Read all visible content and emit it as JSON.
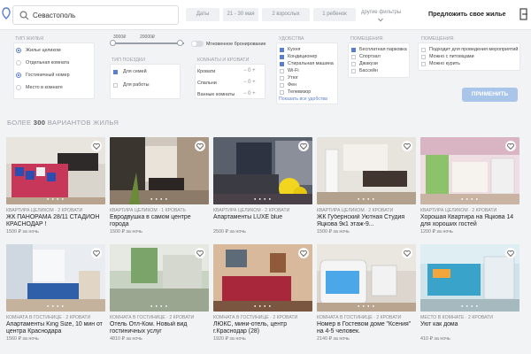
{
  "header": {
    "search_value": "Севастополь",
    "dates": "Даты",
    "date_range": "21 - 30 мая",
    "adults": "2 взрослых",
    "children": "1 ребенок",
    "other_filters": "другие фильтры",
    "offer_link": "Предложить свое жилье",
    "icons": [
      "logo-icon",
      "search-icon",
      "chevron-down-icon",
      "login-icon"
    ]
  },
  "filters": {
    "housing_type": {
      "title": "Тип жилья",
      "options": [
        "Жилье целиком",
        "Отдельная комната",
        "Гостиничный номер",
        "Место в комнате"
      ]
    },
    "price": {
      "min": "3000₽",
      "max": "20000₽"
    },
    "instant_booking": "Мгновенное бронирование",
    "trip_type": {
      "title": "Тип поездки",
      "options": [
        "Для семей",
        "Для работы"
      ]
    },
    "rooms": {
      "title": "Комнаты и кровати",
      "rows": [
        {
          "label": "Кровати",
          "value": "0"
        },
        {
          "label": "Спальни",
          "value": "0"
        },
        {
          "label": "Ванные комнаты",
          "value": "0"
        }
      ]
    },
    "amenities": {
      "title": "Удобства",
      "options": [
        "Кухня",
        "Кондиционер",
        "Стиральная машина",
        "Wi-Fi",
        "Утюг",
        "Фен",
        "Телевизор"
      ],
      "more": "Показать все удобства"
    },
    "facilities": {
      "title": "Помещения",
      "options": [
        "Бесплатная парковка",
        "Спортзал",
        "Джакузи",
        "Бассейн"
      ]
    },
    "rules": {
      "title": "Помещения",
      "options": [
        "Подходит для проведения мероприятий",
        "Можно с питомцами",
        "Можно курить"
      ]
    },
    "apply_label": "Применить"
  },
  "results_count": {
    "prefix": "Более",
    "number": "300",
    "suffix": "вариантов жилья"
  },
  "listings": [
    {
      "type": "Квартира целиком · 2 кровати",
      "title": "ЖК ПАНОРАМА 28/11 СТАДИОН КРАСНОДАР !",
      "price": "1500 ₽ за ночь"
    },
    {
      "type": "Квартира целиком · 1 кровать",
      "title": "Евродвушка в самом центре города",
      "price": "1500 ₽ за ночь"
    },
    {
      "type": "Квартира целиком · 2 кровати",
      "title": "Апартаменты LUXE blue",
      "price": "2500 ₽ за ночь"
    },
    {
      "type": "Квартира целиком · 2 кровати",
      "title": "ЖК Губернский Уютная Студия Яцкова 9к1 этаж-9...",
      "price": "1500 ₽ за ночь"
    },
    {
      "type": "Квартира целиком · 2 кровати",
      "title": "Хорошая Квартира на Яцкова 14 для хороших гостей",
      "price": "1200 ₽ за ночь"
    },
    {
      "type": "Комната в гостинице · 2 кровати",
      "title": "Апартаменты King Size, 10 мин от центра Краснодара",
      "price": "1560 ₽ за ночь"
    },
    {
      "type": "Комната в гостинице · 2 кровати",
      "title": "Отель Отл-Ком. Новый вид гостиничных услуг",
      "price": "4810 ₽ за ночь"
    },
    {
      "type": "Комната в гостинице · 2 кровати",
      "title": "ЛЮКС, мини-отель, центр г.Краснодар (28)",
      "price": "1920 ₽ за ночь"
    },
    {
      "type": "Комната в гостинице · 2 кровати",
      "title": "Номер в Гостевом доме \"Ксения\" на 4-5 человек.",
      "price": "2140 ₽ за ночь"
    },
    {
      "type": "Место в комнате · 2 кровати",
      "title": "Уют как дома",
      "price": "410 ₽ за ночь"
    }
  ]
}
